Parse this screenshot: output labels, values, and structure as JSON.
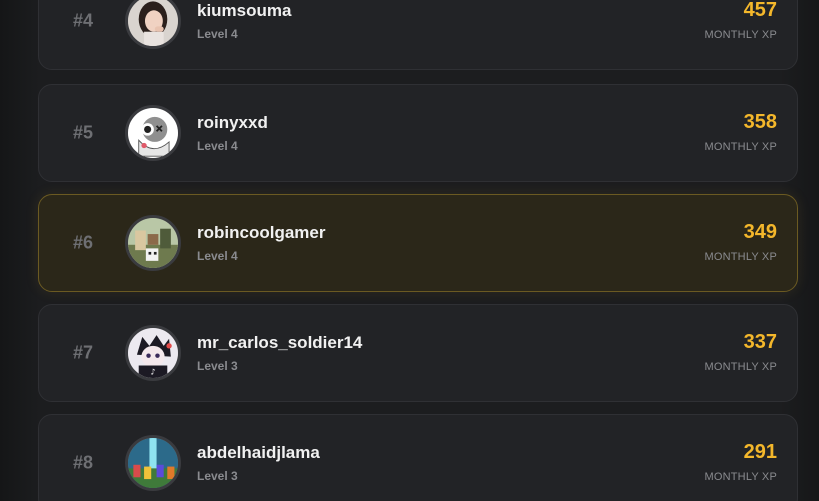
{
  "leaderboard": {
    "xp_label": "MONTHLY XP",
    "accent_color": "#f4b72b",
    "highlight_border_color": "#6b5a22",
    "entries": [
      {
        "rank": "#4",
        "username": "kiumsouma",
        "level": "Level 4",
        "xp": "457",
        "avatar": "girl-photo-avatar",
        "highlighted": false
      },
      {
        "rank": "#5",
        "username": "roinyxxd",
        "level": "Level 4",
        "xp": "358",
        "avatar": "cartoon-character-avatar",
        "highlighted": false
      },
      {
        "rank": "#6",
        "username": "robincoolgamer",
        "level": "Level 4",
        "xp": "349",
        "avatar": "minecraft-scene-avatar",
        "highlighted": true
      },
      {
        "rank": "#7",
        "username": "mr_carlos_soldier14",
        "level": "Level 3",
        "xp": "337",
        "avatar": "anime-tiktok-avatar",
        "highlighted": false
      },
      {
        "rank": "#8",
        "username": "abdelhaidjlama",
        "level": "Level 3",
        "xp": "291",
        "avatar": "minecraft-beacon-avatar",
        "highlighted": false
      }
    ]
  }
}
